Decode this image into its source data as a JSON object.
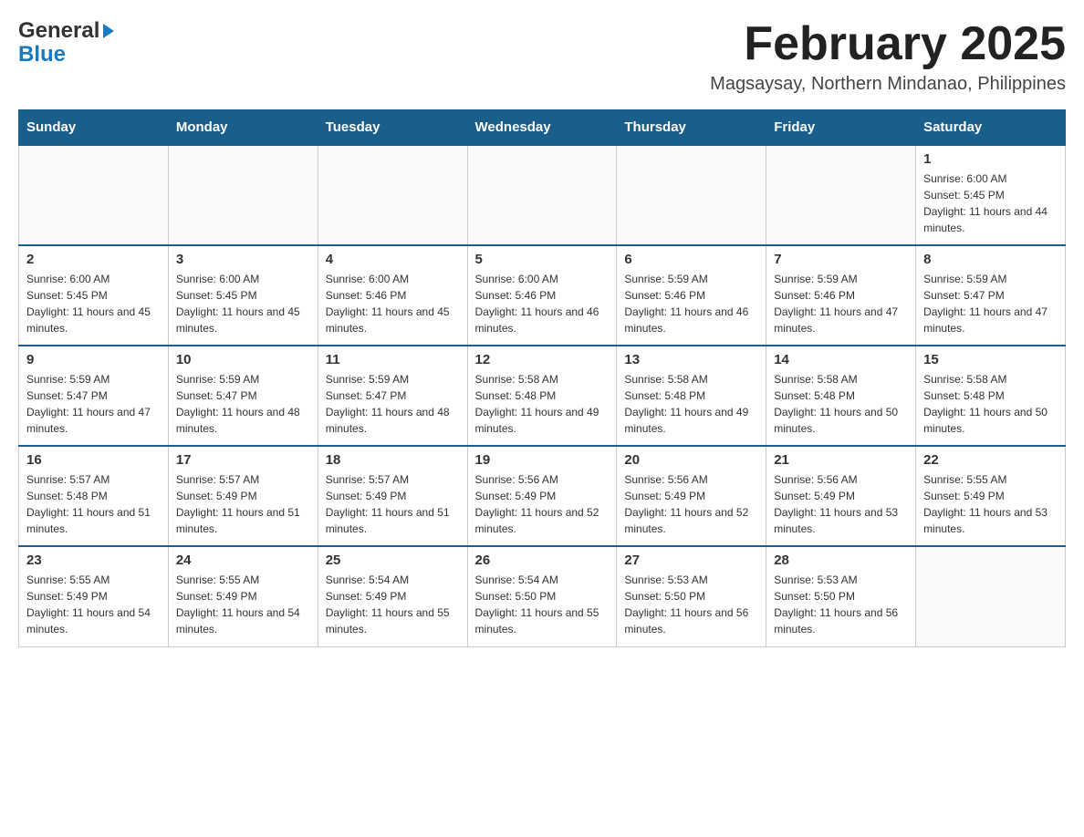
{
  "header": {
    "logo_general": "General",
    "logo_blue": "Blue",
    "month_title": "February 2025",
    "subtitle": "Magsaysay, Northern Mindanao, Philippines"
  },
  "days_of_week": [
    "Sunday",
    "Monday",
    "Tuesday",
    "Wednesday",
    "Thursday",
    "Friday",
    "Saturday"
  ],
  "weeks": [
    [
      {
        "day": "",
        "info": ""
      },
      {
        "day": "",
        "info": ""
      },
      {
        "day": "",
        "info": ""
      },
      {
        "day": "",
        "info": ""
      },
      {
        "day": "",
        "info": ""
      },
      {
        "day": "",
        "info": ""
      },
      {
        "day": "1",
        "info": "Sunrise: 6:00 AM\nSunset: 5:45 PM\nDaylight: 11 hours and 44 minutes."
      }
    ],
    [
      {
        "day": "2",
        "info": "Sunrise: 6:00 AM\nSunset: 5:45 PM\nDaylight: 11 hours and 45 minutes."
      },
      {
        "day": "3",
        "info": "Sunrise: 6:00 AM\nSunset: 5:45 PM\nDaylight: 11 hours and 45 minutes."
      },
      {
        "day": "4",
        "info": "Sunrise: 6:00 AM\nSunset: 5:46 PM\nDaylight: 11 hours and 45 minutes."
      },
      {
        "day": "5",
        "info": "Sunrise: 6:00 AM\nSunset: 5:46 PM\nDaylight: 11 hours and 46 minutes."
      },
      {
        "day": "6",
        "info": "Sunrise: 5:59 AM\nSunset: 5:46 PM\nDaylight: 11 hours and 46 minutes."
      },
      {
        "day": "7",
        "info": "Sunrise: 5:59 AM\nSunset: 5:46 PM\nDaylight: 11 hours and 47 minutes."
      },
      {
        "day": "8",
        "info": "Sunrise: 5:59 AM\nSunset: 5:47 PM\nDaylight: 11 hours and 47 minutes."
      }
    ],
    [
      {
        "day": "9",
        "info": "Sunrise: 5:59 AM\nSunset: 5:47 PM\nDaylight: 11 hours and 47 minutes."
      },
      {
        "day": "10",
        "info": "Sunrise: 5:59 AM\nSunset: 5:47 PM\nDaylight: 11 hours and 48 minutes."
      },
      {
        "day": "11",
        "info": "Sunrise: 5:59 AM\nSunset: 5:47 PM\nDaylight: 11 hours and 48 minutes."
      },
      {
        "day": "12",
        "info": "Sunrise: 5:58 AM\nSunset: 5:48 PM\nDaylight: 11 hours and 49 minutes."
      },
      {
        "day": "13",
        "info": "Sunrise: 5:58 AM\nSunset: 5:48 PM\nDaylight: 11 hours and 49 minutes."
      },
      {
        "day": "14",
        "info": "Sunrise: 5:58 AM\nSunset: 5:48 PM\nDaylight: 11 hours and 50 minutes."
      },
      {
        "day": "15",
        "info": "Sunrise: 5:58 AM\nSunset: 5:48 PM\nDaylight: 11 hours and 50 minutes."
      }
    ],
    [
      {
        "day": "16",
        "info": "Sunrise: 5:57 AM\nSunset: 5:48 PM\nDaylight: 11 hours and 51 minutes."
      },
      {
        "day": "17",
        "info": "Sunrise: 5:57 AM\nSunset: 5:49 PM\nDaylight: 11 hours and 51 minutes."
      },
      {
        "day": "18",
        "info": "Sunrise: 5:57 AM\nSunset: 5:49 PM\nDaylight: 11 hours and 51 minutes."
      },
      {
        "day": "19",
        "info": "Sunrise: 5:56 AM\nSunset: 5:49 PM\nDaylight: 11 hours and 52 minutes."
      },
      {
        "day": "20",
        "info": "Sunrise: 5:56 AM\nSunset: 5:49 PM\nDaylight: 11 hours and 52 minutes."
      },
      {
        "day": "21",
        "info": "Sunrise: 5:56 AM\nSunset: 5:49 PM\nDaylight: 11 hours and 53 minutes."
      },
      {
        "day": "22",
        "info": "Sunrise: 5:55 AM\nSunset: 5:49 PM\nDaylight: 11 hours and 53 minutes."
      }
    ],
    [
      {
        "day": "23",
        "info": "Sunrise: 5:55 AM\nSunset: 5:49 PM\nDaylight: 11 hours and 54 minutes."
      },
      {
        "day": "24",
        "info": "Sunrise: 5:55 AM\nSunset: 5:49 PM\nDaylight: 11 hours and 54 minutes."
      },
      {
        "day": "25",
        "info": "Sunrise: 5:54 AM\nSunset: 5:49 PM\nDaylight: 11 hours and 55 minutes."
      },
      {
        "day": "26",
        "info": "Sunrise: 5:54 AM\nSunset: 5:50 PM\nDaylight: 11 hours and 55 minutes."
      },
      {
        "day": "27",
        "info": "Sunrise: 5:53 AM\nSunset: 5:50 PM\nDaylight: 11 hours and 56 minutes."
      },
      {
        "day": "28",
        "info": "Sunrise: 5:53 AM\nSunset: 5:50 PM\nDaylight: 11 hours and 56 minutes."
      },
      {
        "day": "",
        "info": ""
      }
    ]
  ]
}
